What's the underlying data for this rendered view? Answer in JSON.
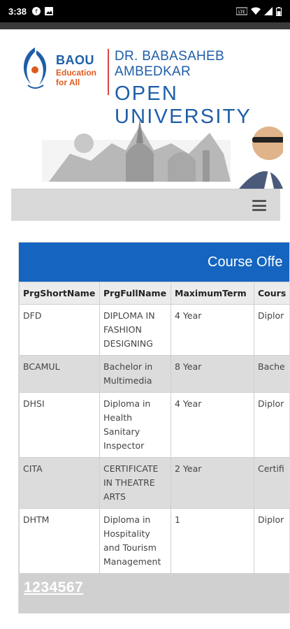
{
  "status_bar": {
    "time": "3:38",
    "left_icons": [
      "notification-f-icon",
      "image-icon"
    ],
    "right_icons": [
      "volte-icon",
      "wifi-icon",
      "signal-icon",
      "battery-icon"
    ]
  },
  "header": {
    "logo_abbr": "BAOU",
    "logo_tag_line1": "Education",
    "logo_tag_line2": "for All",
    "university_line1": "DR. BABASAHEB AMBEDKAR",
    "university_line2": "OPEN UNIVERSITY"
  },
  "nav": {
    "menu_icon": "hamburger-menu-icon"
  },
  "panel": {
    "title": "Course Offe"
  },
  "table": {
    "headers": [
      "PrgShortName",
      "PrgFullName",
      "MaximumTerm",
      "Cours"
    ],
    "rows": [
      [
        "DFD",
        "DIPLOMA IN FASHION DESIGNING",
        "4 Year",
        "Diplor"
      ],
      [
        "BCAMUL",
        "Bachelor in Multimedia",
        "8 Year",
        "Bache"
      ],
      [
        "DHSI",
        "Diploma in Health Sanitary Inspector",
        "4 Year",
        "Diplor"
      ],
      [
        "CITA",
        "CERTIFICATE IN THEATRE ARTS",
        "2 Year",
        "Certifi"
      ],
      [
        "DHTM",
        "Diploma in Hospitality and Tourism Management",
        "1",
        "Diplor"
      ]
    ],
    "pager": "1234567"
  },
  "colors": {
    "accent": "#1565c0",
    "brand_blue": "#1e5ea8",
    "brand_orange": "#e05a1e"
  }
}
